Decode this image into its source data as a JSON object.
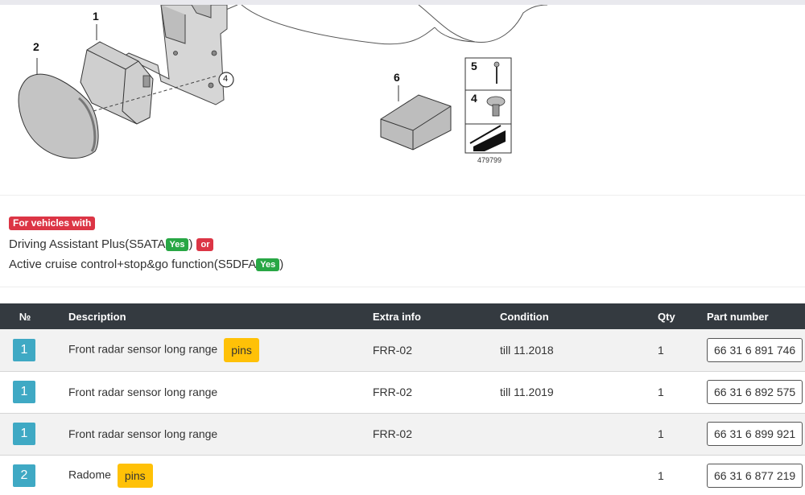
{
  "diagram": {
    "callouts": [
      "1",
      "2",
      "4",
      "6",
      "5",
      "4"
    ],
    "figure_id": "479799"
  },
  "conditions": {
    "badge": "For vehicles with",
    "lines": [
      {
        "text": "Driving Assistant Plus(S5ATA",
        "tag": "Yes",
        "suffix": ")",
        "joiner": "or"
      },
      {
        "text": "Active cruise control+stop&go function(S5DFA",
        "tag": "Yes",
        "suffix": ")"
      }
    ]
  },
  "table": {
    "headers": {
      "no": "№",
      "description": "Description",
      "extra": "Extra info",
      "condition": "Condition",
      "qty": "Qty",
      "part": "Part number"
    },
    "rows": [
      {
        "no": "1",
        "description": "Front radar sensor long range",
        "badge": "pins",
        "extra": "FRR-02",
        "condition": "till 11.2018",
        "qty": "1",
        "part": "66 31 6 891 746"
      },
      {
        "no": "1",
        "description": "Front radar sensor long range",
        "badge": "",
        "extra": "FRR-02",
        "condition": "till 11.2019",
        "qty": "1",
        "part": "66 31 6 892 575"
      },
      {
        "no": "1",
        "description": "Front radar sensor long range",
        "badge": "",
        "extra": "FRR-02",
        "condition": "",
        "qty": "1",
        "part": "66 31 6 899 921"
      },
      {
        "no": "2",
        "description": "Radome",
        "badge": "pins",
        "extra": "",
        "condition": "",
        "qty": "1",
        "part": "66 31 6 877 219"
      }
    ]
  },
  "colors": {
    "header_bg": "#343a40",
    "position_badge": "#3fa9c4",
    "pins_badge": "#ffc107",
    "yes_badge": "#28a745",
    "condition_badge": "#dc3545"
  }
}
